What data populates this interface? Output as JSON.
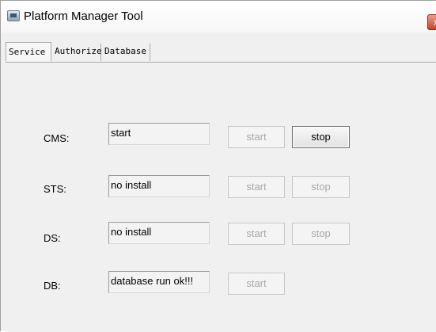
{
  "window": {
    "title": "Platform Manager Tool",
    "close_label": "x"
  },
  "tabs": [
    {
      "label": "Service"
    },
    {
      "label": "Authorize"
    },
    {
      "label": "Database"
    }
  ],
  "services": {
    "cms": {
      "label": "CMS:",
      "status": "start",
      "start_label": "start",
      "stop_label": "stop"
    },
    "sts": {
      "label": "STS:",
      "status": "no install",
      "start_label": "start",
      "stop_label": "stop"
    },
    "ds": {
      "label": "DS:",
      "status": "no install",
      "start_label": "start",
      "stop_label": "stop"
    },
    "db": {
      "label": "DB:",
      "status": "database run ok!!!",
      "start_label": "start"
    }
  }
}
